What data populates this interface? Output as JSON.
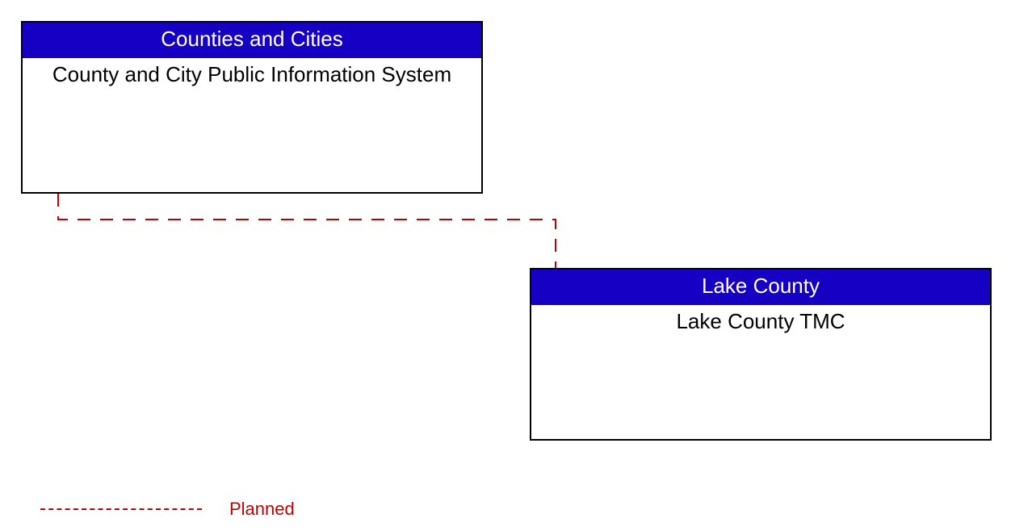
{
  "nodes": {
    "top": {
      "header": "Counties and Cities",
      "body": "County and City Public Information System"
    },
    "bottom": {
      "header": "Lake County",
      "body": "Lake County TMC"
    }
  },
  "legend": {
    "label": "Planned"
  },
  "colors": {
    "header_bg": "#1500c4",
    "header_fg": "#ffffff",
    "border": "#000000",
    "connector": "#c00000"
  }
}
